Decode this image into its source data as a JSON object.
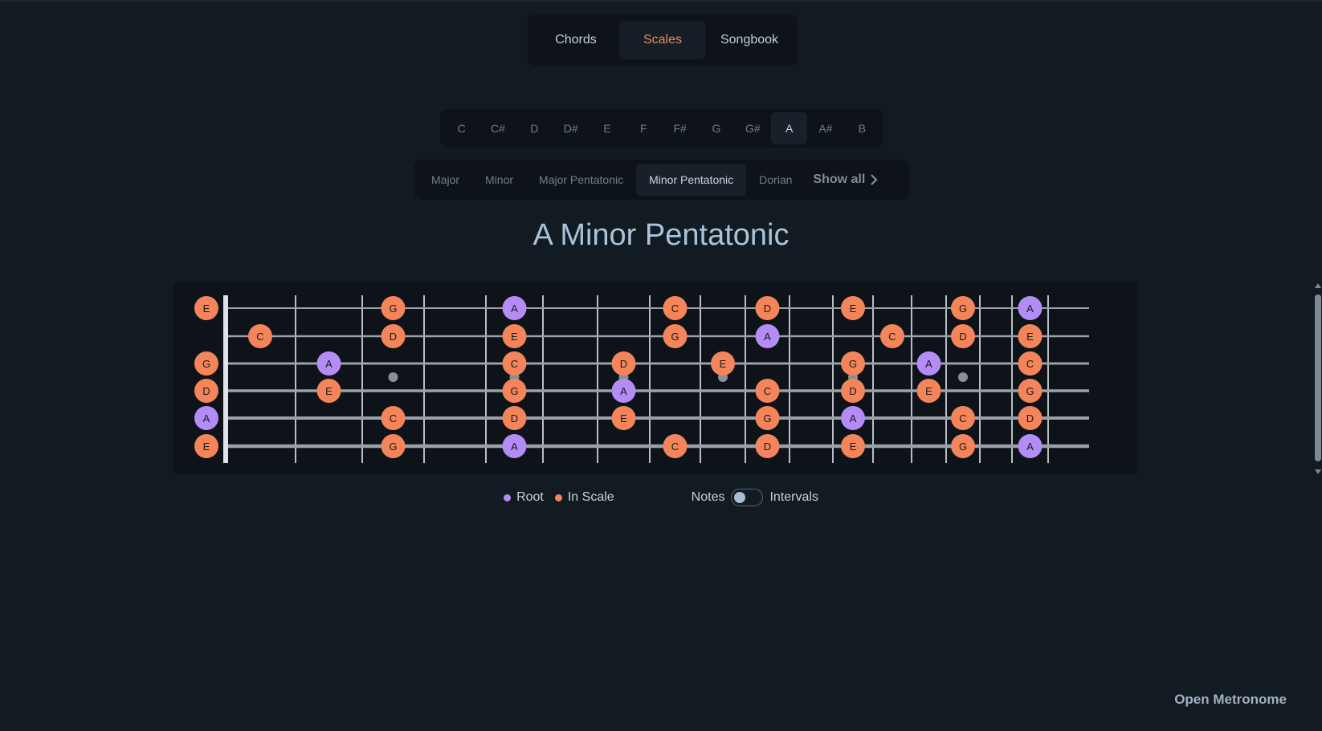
{
  "nav": {
    "tabs": [
      {
        "label": "Chords",
        "active": false
      },
      {
        "label": "Scales",
        "active": true
      },
      {
        "label": "Songbook",
        "active": false
      }
    ]
  },
  "keys": {
    "items": [
      "C",
      "C#",
      "D",
      "D#",
      "E",
      "F",
      "F#",
      "G",
      "G#",
      "A",
      "A#",
      "B"
    ],
    "selected": "A"
  },
  "scales": {
    "items": [
      "Major",
      "Minor",
      "Major Pentatonic",
      "Minor Pentatonic",
      "Dorian"
    ],
    "selected": "Minor Pentatonic",
    "show_all_label": "Show all"
  },
  "title": "A Minor Pentatonic",
  "fretboard": {
    "frets": 15,
    "inlay_frets": [
      3,
      5,
      7,
      9,
      12,
      15
    ],
    "strings": [
      {
        "open": "E",
        "notes": [
          {
            "fret": 0,
            "note": "E"
          },
          {
            "fret": 3,
            "note": "G"
          },
          {
            "fret": 5,
            "note": "A",
            "root": true
          },
          {
            "fret": 8,
            "note": "C"
          },
          {
            "fret": 10,
            "note": "D"
          },
          {
            "fret": 12,
            "note": "E"
          },
          {
            "fret": 15,
            "note": "G"
          },
          {
            "fret": 17,
            "note": "A",
            "root": true
          }
        ]
      },
      {
        "open": "B",
        "notes": [
          {
            "fret": 1,
            "note": "C"
          },
          {
            "fret": 3,
            "note": "D"
          },
          {
            "fret": 5,
            "note": "E"
          },
          {
            "fret": 8,
            "note": "G"
          },
          {
            "fret": 10,
            "note": "A",
            "root": true
          },
          {
            "fret": 13,
            "note": "C"
          },
          {
            "fret": 15,
            "note": "D"
          },
          {
            "fret": 17,
            "note": "E"
          }
        ]
      },
      {
        "open": "G",
        "notes": [
          {
            "fret": 0,
            "note": "G"
          },
          {
            "fret": 2,
            "note": "A",
            "root": true
          },
          {
            "fret": 5,
            "note": "C"
          },
          {
            "fret": 7,
            "note": "D"
          },
          {
            "fret": 9,
            "note": "E"
          },
          {
            "fret": 12,
            "note": "G"
          },
          {
            "fret": 14,
            "note": "A",
            "root": true
          },
          {
            "fret": 17,
            "note": "C"
          }
        ]
      },
      {
        "open": "D",
        "notes": [
          {
            "fret": 0,
            "note": "D"
          },
          {
            "fret": 2,
            "note": "E"
          },
          {
            "fret": 5,
            "note": "G"
          },
          {
            "fret": 7,
            "note": "A",
            "root": true
          },
          {
            "fret": 10,
            "note": "C"
          },
          {
            "fret": 12,
            "note": "D"
          },
          {
            "fret": 14,
            "note": "E"
          },
          {
            "fret": 17,
            "note": "G"
          }
        ]
      },
      {
        "open": "A",
        "notes": [
          {
            "fret": 0,
            "note": "A",
            "root": true
          },
          {
            "fret": 3,
            "note": "C"
          },
          {
            "fret": 5,
            "note": "D"
          },
          {
            "fret": 7,
            "note": "E"
          },
          {
            "fret": 10,
            "note": "G"
          },
          {
            "fret": 12,
            "note": "A",
            "root": true
          },
          {
            "fret": 15,
            "note": "C"
          },
          {
            "fret": 17,
            "note": "D"
          }
        ]
      },
      {
        "open": "E",
        "notes": [
          {
            "fret": 0,
            "note": "E"
          },
          {
            "fret": 3,
            "note": "G"
          },
          {
            "fret": 5,
            "note": "A",
            "root": true
          },
          {
            "fret": 8,
            "note": "C"
          },
          {
            "fret": 10,
            "note": "D"
          },
          {
            "fret": 12,
            "note": "E"
          },
          {
            "fret": 15,
            "note": "G"
          },
          {
            "fret": 17,
            "note": "A",
            "root": true
          }
        ]
      }
    ],
    "colors": {
      "root": "#b38cf5",
      "in_scale": "#f4845a",
      "string": "#9aa1a8",
      "fret": "#b8bec4",
      "nut": "#e0e3e6",
      "inlay": "#8a9097"
    }
  },
  "legend": {
    "root_label": "Root",
    "in_scale_label": "In Scale",
    "notes_label": "Notes",
    "intervals_label": "Intervals"
  },
  "metronome_label": "Open Metronome"
}
